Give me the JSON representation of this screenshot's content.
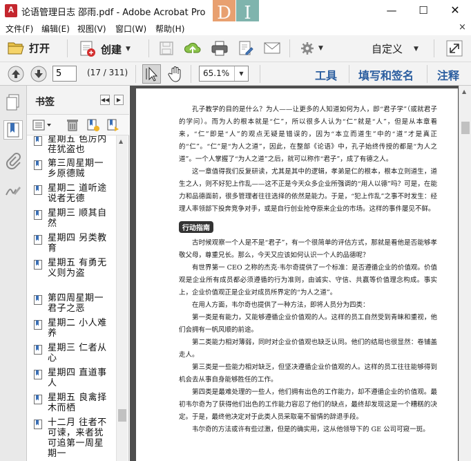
{
  "window": {
    "title": "论语管理日志 邵雨.pdf - Adobe Acrobat Pro",
    "app_icon_letter": "A",
    "watermark_left": "D",
    "watermark_right": "I",
    "minimize": "—",
    "maximize": "☐",
    "close": "✕"
  },
  "menu": {
    "items": [
      "文件(F)",
      "编辑(E)",
      "视图(V)",
      "窗口(W)",
      "帮助(H)"
    ],
    "close_doc": "×"
  },
  "toolbar": {
    "open_label": "打开",
    "create_label": "创建",
    "customize_label": "自定义"
  },
  "nav": {
    "page_value": "5",
    "page_count": "(17 / 311)",
    "zoom_value": "65.1%",
    "tools_label": "工具",
    "fill_sign_label": "填写和签名",
    "comment_label": "注释"
  },
  "bookmarks": {
    "title": "书签",
    "items": [
      {
        "text": "星期五 色厉内荏犹盗也"
      },
      {
        "text": "第三周星期一 乡原德贼"
      },
      {
        "text": "星期二 道听途说者无德"
      },
      {
        "text": "星期三 顺其自然"
      },
      {
        "text": "星期四 另类教育"
      },
      {
        "text": "星期五 有勇无义则为盗"
      },
      {
        "text": "第四周星期一 君子之恶"
      },
      {
        "text": "星期二 小人难养"
      },
      {
        "text": "星期三 仁者从心"
      },
      {
        "text": "星期四 直道事人"
      },
      {
        "text": "星期五 良禽择木而栖"
      },
      {
        "text": "十二月 往者不可谏，来者犹可追第一周星期一"
      }
    ]
  },
  "document": {
    "paragraphs_top": [
      "孔子教学的目的是什么？为人——让更多的人知道如何为人，即“君子学”（或就君子的学问）。而为人的根本就是“仁”，所以很多人认为“仁”就是“人”，但是从本章看来，“仁”即是“人”的观点无疑是错误的，因为“本立而道生”中的“道”才是真正的“仁”。“仁”是“为人之道”，因此，在整部《论语》中，孔子始终传授的都是“为人之道”。一个人掌握了“为人之道”之后，就可以称作“君子”，成了有德之人。",
      "这一章值得我们反复研读，尤其是其中的逻辑，孝弟是仁的根本，根本立则道生，道生之人，则不好犯上作乱——这不正是今天众多企业所强调的“用人以德”吗？可是，在能力和品德面前，很多管理者往往选择的依然是能力。于是，“犯上作乱”之事不时发生：经理人率领部下投奔竞争对手，或是自行创业抢夺原来企业的市场。这样的事件屡见不鲜。"
    ],
    "section_title": "行动指南",
    "paragraphs_bottom": [
      "古时候观察一个人是不是“君子”，有一个很简单的评估方式，那就是看他是否能够孝敬父母，尊重兄长。那么，今天又应该如何认识一个人的品德呢？",
      "有世界第一 CEO 之称的杰克·韦尔奇提供了一个标准：是否遵循企业的价值观。价值观是企业所有成员都必须遵循的行为准则，由诚实、守信、共赢等价值理念构成。事实上，企业价值观正是企业对成员所界定的“为人之道”。",
      "在用人方面，韦尔奇也提供了一种方法，即将人员分为四类：",
      "第一类是有能力，又能够遵循企业价值观的人。这样的员工自然受到青睐和重视，他们会拥有一帆风顺的前途。",
      "第二类能力相对薄弱，同时对企业价值观也缺乏认同。他们的结局也很显然：卷铺盖走人。",
      "第三类是一些能力相对缺乏，但坚决遵循企业价值观的人。这样的员工往往能够得到机会去从事自身能够胜任的工作。",
      "第四类是最难处理的一些人，他们拥有出色的工作能力，却不遵循企业的价值观。最初韦尔奇为了获得他们出色的工作能力容忍了他们的缺点，最终却发现这是一个糟糕的决定。于是，最终他决定对于此类人员采取毫不留情的辞退手段。",
      "韦尔奇的方法或许有些过激，但是的确实用，这从他领导下的 GE 公司可窥一斑。"
    ]
  }
}
